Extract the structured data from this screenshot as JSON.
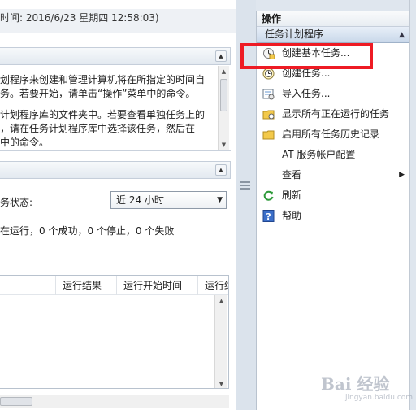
{
  "left": {
    "refresh_text": "时间: 2016/6/23 星期四 12:58:03)",
    "overview_lines": [
      "划程序来创建和管理计算机将在所指定的时间自",
      "务。若要开始，请单击“操作”菜单中的命令。",
      "",
      "计划程序库的文件夹中。若要查看单独任务上的",
      "，请在任务计划程序库中选择该任务，然后在",
      "中的命令。"
    ],
    "status_label": "务状态:",
    "period_select": "近 24 小时",
    "summary": "在运行，0 个成功，0 个停止，0 个失败",
    "table_headers": [
      "",
      "运行结果",
      "运行开始时间",
      "运行结"
    ]
  },
  "actions": {
    "title": "操作",
    "group": "任务计划程序",
    "items": [
      {
        "label": "创建基本任务...",
        "icon": "create-basic-task-icon",
        "submenu": false
      },
      {
        "label": "创建任务...",
        "icon": "create-task-icon",
        "submenu": false
      },
      {
        "label": "导入任务...",
        "icon": "import-task-icon",
        "submenu": false
      },
      {
        "label": "显示所有正在运行的任务",
        "icon": "running-tasks-icon",
        "submenu": false
      },
      {
        "label": "启用所有任务历史记录",
        "icon": "history-icon",
        "submenu": false
      },
      {
        "label": "AT 服务帐户配置",
        "icon": "",
        "submenu": false
      },
      {
        "label": "查看",
        "icon": "",
        "submenu": true
      },
      {
        "label": "刷新",
        "icon": "refresh-icon",
        "submenu": false
      },
      {
        "label": "帮助",
        "icon": "help-icon",
        "submenu": false
      }
    ]
  },
  "colors": {
    "highlight": "#ee1b24",
    "group_header": "#c9d8ea",
    "pane_bg": "#dfe6ee"
  }
}
